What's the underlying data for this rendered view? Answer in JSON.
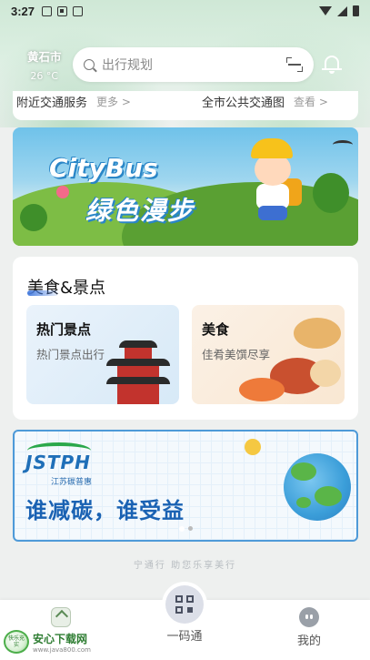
{
  "status": {
    "time": "3:27"
  },
  "header": {
    "city": "黄石市",
    "temperature": "26 °C",
    "search_placeholder": "出行规划"
  },
  "services": {
    "left_label": "附近交通服务",
    "left_more": "更多 >",
    "right_label": "全市公共交通图",
    "right_more": "查看 >"
  },
  "banner_top": {
    "title_en": "CityBus",
    "title_zh": "绿色漫步"
  },
  "food_section": {
    "title": "美食&景点",
    "tiles": [
      {
        "title": "热门景点",
        "subtitle": "热门景点出行"
      },
      {
        "title": "美食",
        "subtitle": "佳肴美馔尽享"
      }
    ]
  },
  "banner_bottom": {
    "logo": "JSTPH",
    "logo_sub": "江苏碳普惠",
    "slogan": "谁减碳，谁受益"
  },
  "footer_note": "宁通行 助您乐享美行",
  "bottom_nav": {
    "qr_label": "一码通",
    "mine_label": "我的"
  },
  "watermark": {
    "badge": "快乐充实",
    "name": "安心下载网",
    "url": "www.java800.com"
  },
  "colors": {
    "accent": "#4a7fe0",
    "banner_blue": "#1a62b3",
    "green": "#2aa84a"
  }
}
